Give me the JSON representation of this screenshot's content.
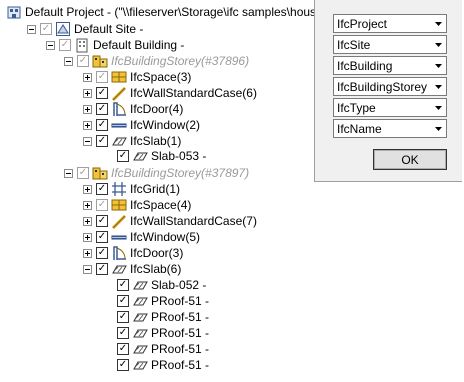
{
  "tree": {
    "project": "Default Project - (\"\\\\fileserver\\Storage\\ifc samples\\house",
    "site": "Default Site -",
    "building": "Default Building -",
    "storey1": {
      "label": "IfcBuildingStorey(#37896)",
      "space": "IfcSpace(3)",
      "wall": "IfcWallStandardCase(6)",
      "door": "IfcDoor(4)",
      "window": "IfcWindow(2)",
      "slab": "IfcSlab(1)",
      "slab_item": "Slab-053 -"
    },
    "storey2": {
      "label": "IfcBuildingStorey(#37897)",
      "grid": "IfcGrid(1)",
      "space": "IfcSpace(4)",
      "wall": "IfcWallStandardCase(7)",
      "window": "IfcWindow(5)",
      "door": "IfcDoor(3)",
      "slab": "IfcSlab(6)",
      "slab_items": [
        "Slab-052 -",
        "PRoof-51 -",
        "PRoof-51 -",
        "PRoof-51 -",
        "PRoof-51 -",
        "PRoof-51 -"
      ]
    }
  },
  "panel": {
    "selects": [
      "IfcProject",
      "IfcSite",
      "IfcBuilding",
      "IfcBuildingStorey",
      "IfcType",
      "IfcName"
    ],
    "ok_label": "OK"
  },
  "icons": {
    "project": "ifc-project-icon",
    "site": "ifc-site-icon",
    "building": "ifc-building-icon",
    "storey": "ifc-storey-icon",
    "space": "ifc-space-icon",
    "wall": "ifc-wall-icon",
    "door": "ifc-door-icon",
    "window": "ifc-window-icon",
    "slab": "ifc-slab-icon",
    "grid": "ifc-grid-icon"
  },
  "colors": {
    "disabled_text": "#9a9a9a",
    "panel_bg": "#f0f0f0"
  }
}
